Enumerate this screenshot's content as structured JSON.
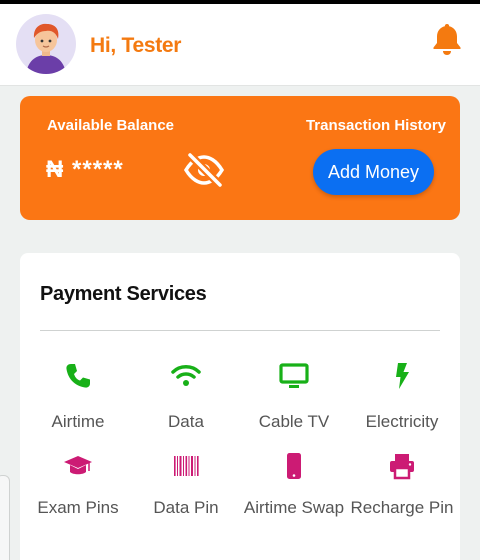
{
  "header": {
    "greeting": "Hi, Tester",
    "avatar_icon": "user-avatar-icon",
    "notification_icon": "bell-icon"
  },
  "balance": {
    "label": "Available Balance",
    "currency_symbol": "₦",
    "masked_amount": "*****",
    "visibility_icon": "eye-slash-icon",
    "transaction_history_label": "Transaction History",
    "add_money_label": "Add Money"
  },
  "services": {
    "title": "Payment Services",
    "items": [
      {
        "label": "Airtime",
        "icon": "phone-icon",
        "color": "#18b018"
      },
      {
        "label": "Data",
        "icon": "wifi-icon",
        "color": "#18b018"
      },
      {
        "label": "Cable TV",
        "icon": "tv-icon",
        "color": "#18b018"
      },
      {
        "label": "Electricity",
        "icon": "bolt-icon",
        "color": "#18b018"
      },
      {
        "label": "Exam Pins",
        "icon": "graduation-cap-icon",
        "color": "#cc1b74"
      },
      {
        "label": "Data Pin",
        "icon": "barcode-icon",
        "color": "#cc1b74"
      },
      {
        "label": "Airtime Swap",
        "icon": "mobile-icon",
        "color": "#cc1b74"
      },
      {
        "label": "Recharge Pin",
        "icon": "printer-icon",
        "color": "#cc1b74"
      }
    ]
  },
  "colors": {
    "brand_orange": "#fb7614",
    "primary_blue": "#0b6ff2",
    "service_green": "#18b018",
    "service_pink": "#cc1b74"
  }
}
